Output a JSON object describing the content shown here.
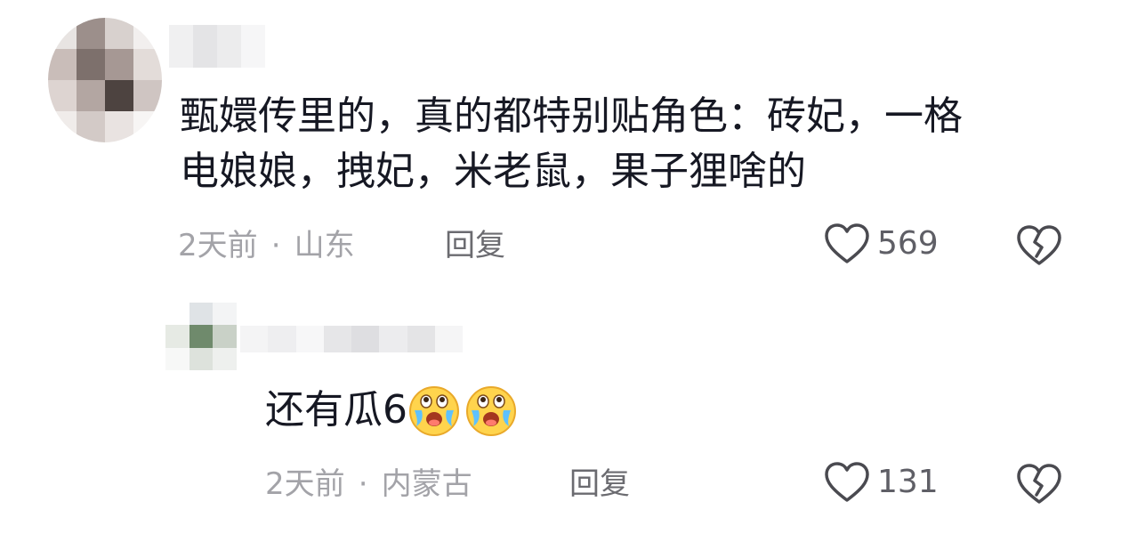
{
  "comments": [
    {
      "text_line1": "甄嬛传里的，真的都特别贴角色：砖妃，一格",
      "text_line2": "电娘娘，拽妃，米老鼠，果子狸啥的",
      "time": "2天前",
      "sep": "·",
      "location": "山东",
      "reply_label": "回复",
      "likes": "569"
    },
    {
      "text": "还有瓜6",
      "emojis": [
        "crying-laughing-emoji",
        "crying-laughing-emoji"
      ],
      "time": "2天前",
      "sep": "·",
      "location": "内蒙古",
      "reply_label": "回复",
      "likes": "131"
    }
  ],
  "icons": {
    "like": "heart-outline-icon",
    "dislike": "broken-heart-outline-icon"
  },
  "colors": {
    "text": "#161823",
    "meta": "#a3a3a8",
    "reply": "#6b6b70",
    "icon": "#4a4a50"
  }
}
